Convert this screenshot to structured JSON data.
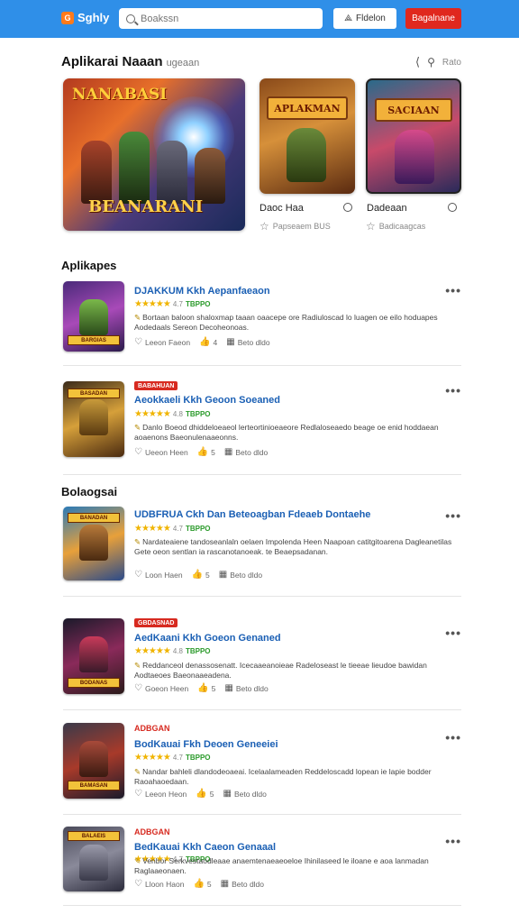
{
  "header": {
    "logo_mark": "G",
    "logo_text": "Sghly",
    "search_placeholder": "Boakssn",
    "button_secondary": "Fldelon",
    "button_primary": "Bagalnane"
  },
  "featured": {
    "title": "Aplikarai Naaan",
    "subtitle": "ugeaan",
    "action_label": "Rato",
    "big_card": {
      "line1": "NANABASI",
      "line2": "BEANARANI"
    },
    "cards": [
      {
        "banner": "APLAKMAN",
        "caption": "Daoc Haa",
        "meta": "Papseaem BUS"
      },
      {
        "banner": "SACIAAN",
        "caption": "Dadeaan",
        "meta": "Badicaagcas"
      }
    ]
  },
  "sections": [
    {
      "label": "Aplikapes"
    },
    {
      "label": "Bolaogsai"
    }
  ],
  "items": [
    {
      "badge": "",
      "title": "DJAKKUM Kkh Aepanfaeaon",
      "rating_num": "4.7",
      "price": "TBPPO",
      "desc": "Bortaan baloon shaloxmap taaan oaacepe ore Radiuloscad lo luagen oe eilo hoduapes Aodedaals Sereon Decoheonoas.",
      "likes": "Leeon Faeon",
      "votes": "4",
      "date": "Beto dldo",
      "thumb_text": "BARGIAS"
    },
    {
      "badge": "BABAHUAN",
      "title": "Aeokkaeli Kkh Geoon Soeaned",
      "rating_num": "4.8",
      "price": "TBPPO",
      "desc": "Danlo Boeod dhiddeloeaeol lerteortinioeaeore Redlaloseaedo beage oe enid hoddaean aoaenons Baeonulenaaeonns.",
      "likes": "Ueeon Heen",
      "votes": "5",
      "date": "Beto dldo",
      "thumb_text": "BASADAN"
    },
    {
      "badge": "",
      "title": "UDBFRUA Ckh Dan Beteoagban Fdeaeb Dontaehe",
      "rating_num": "4.7",
      "price": "TBPPO",
      "desc": "Nardateaiene tandoseanlaln oelaen Impolenda Heen Naapoan catitgitoarena Dagleanetilas Gete oeon sentlan ia rascanotanoeak. te Beaepsadanan.",
      "likes": "Loon Haen",
      "votes": "5",
      "date": "Beto dldo",
      "thumb_text": "BANADAN"
    },
    {
      "badge": "GBDASNAD",
      "title": "AedKaani Kkh Goeon Genaned",
      "rating_num": "4.8",
      "price": "TBPPO",
      "desc": "Reddanceol denassosenatt. Icecaaeanoieae Radeloseast le tieeae lieudoe bawidan Aodtaeoes Baeonaaeadena.",
      "likes": "Goeon Heen",
      "votes": "5",
      "date": "Beto dldo",
      "thumb_text": "BODANAS"
    },
    {
      "badge_text": "ADBGAN",
      "title": "BodKauai Fkh Deoen Geneeiei",
      "rating_num": "4.7",
      "price": "TBPPO",
      "desc": "Nandar bahleli dlandodeoaeai. Icelaalameaden Reddeloscadd lopean ie lapie bodder Raoahaoedaan.",
      "likes": "Leeon Heon",
      "votes": "5",
      "date": "Beto dldo",
      "thumb_text": "BAMASAN"
    },
    {
      "badge_text": "ADBGAN",
      "title": "BedKauai Kkh Caeon Genaaal",
      "rating_num": "4.7",
      "price": "TBPPO",
      "desc": "Venbor Serkvestaodleaae anaemtenaeaeoeloe Ihinilaseed le iloane e aoa lanmadan Raglaaeonaen.",
      "likes": "Lloon Haon",
      "votes": "5",
      "date": "Beto dldo",
      "thumb_text": "BALAEIS"
    }
  ]
}
